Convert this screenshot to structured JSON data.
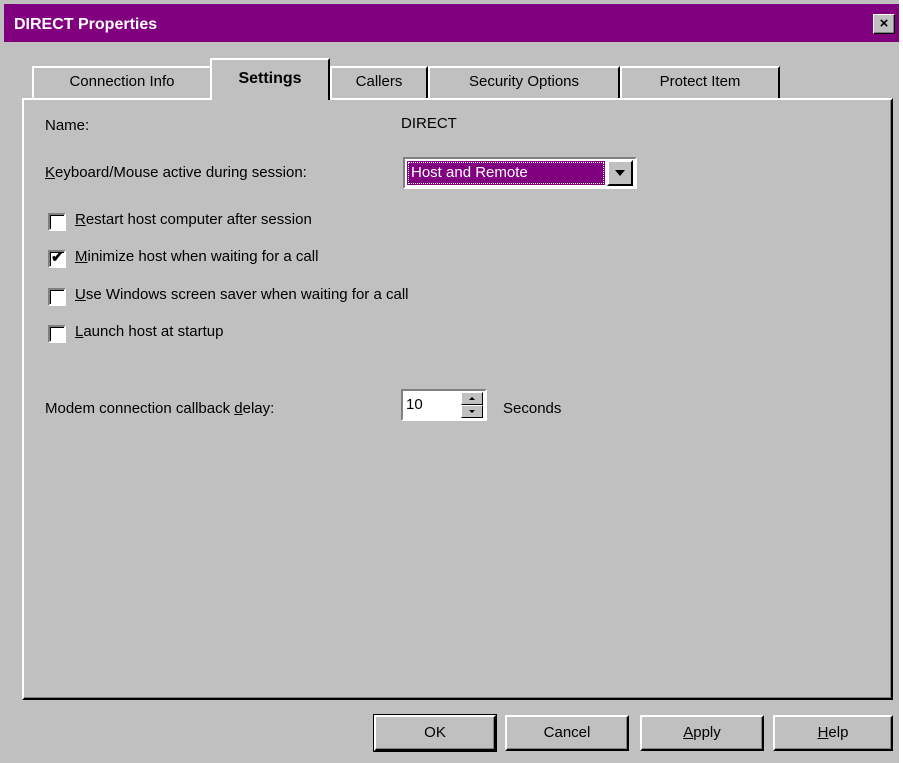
{
  "window": {
    "title": "DIRECT Properties",
    "close_label": "×"
  },
  "tabs": [
    {
      "label": "Connection Info",
      "active": false
    },
    {
      "label": "Settings",
      "active": true
    },
    {
      "label": "Callers",
      "active": false
    },
    {
      "label": "Security Options",
      "active": false
    },
    {
      "label": "Protect Item",
      "active": false
    }
  ],
  "settings": {
    "name_label": "Name:",
    "name_value": "DIRECT",
    "keyboard_label_u": "K",
    "keyboard_label_rest": "eyboard/Mouse active during session:",
    "keyboard_value": "Host and Remote",
    "checkboxes": [
      {
        "u": "R",
        "rest": "estart host computer after session",
        "checked": false
      },
      {
        "u": "M",
        "rest": "inimize host when waiting for a call",
        "checked": true
      },
      {
        "u": "U",
        "rest": "se Windows screen saver when waiting for a call",
        "checked": false
      },
      {
        "u": "L",
        "rest": "aunch host at startup",
        "checked": false
      }
    ],
    "delay_label_pre": "Modem connection callback ",
    "delay_label_u": "d",
    "delay_label_post": "elay:",
    "delay_value": "10",
    "delay_unit": "Seconds"
  },
  "buttons": {
    "ok": "OK",
    "cancel": "Cancel",
    "apply_u": "A",
    "apply_rest": "pply",
    "help_u": "H",
    "help_rest": "elp"
  },
  "colors": {
    "title_bar": "#800080",
    "face": "#c0c0c0",
    "selection": "#800080"
  }
}
